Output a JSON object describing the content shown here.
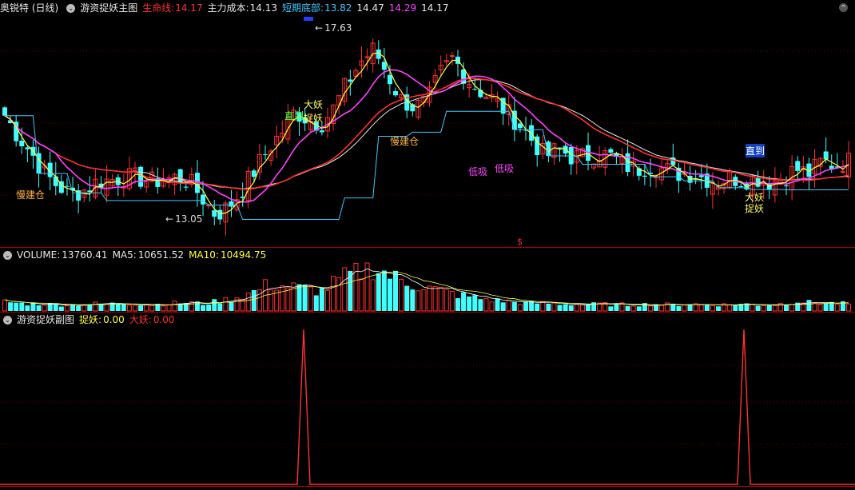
{
  "main_panel": {
    "title": "奥锐特 (日线)",
    "indicator_name": "游资捉妖主图",
    "lifeline_label": "生命线:",
    "lifeline_value": "14.17",
    "cost_label": "主力成本:",
    "cost_value": "14.13",
    "bottom_label": "短期底部:",
    "bottom_value": "13.82",
    "v4": "14.47",
    "v5": "14.29",
    "v6": "14.17",
    "high_label": "17.63",
    "low_label": "13.05",
    "annotations": [
      "慢建仓",
      "大妖",
      "捉妖",
      "直到",
      "慢建仓",
      "低吸",
      "低吸",
      "直到",
      "大妖",
      "捉妖"
    ]
  },
  "volume_panel": {
    "label": "VOLUME:",
    "volume_value": "13760.41",
    "ma5_label": "MA5:",
    "ma5_value": "10651.52",
    "ma10_label": "MA10:",
    "ma10_value": "10494.75"
  },
  "sub_panel": {
    "indicator_name": "游资捉妖副图",
    "zhuoyao_label": "捉妖:",
    "zhuoyao_value": "0.00",
    "dayao_label": "大妖:",
    "dayao_value": "0.00"
  },
  "colors": {
    "up": "#ff3030",
    "down": "#40ffff",
    "lifeline": "#ff3030",
    "cost": "#e8e8e8",
    "bottom": "#40c8ff",
    "magenta": "#ff40ff",
    "yellow": "#ffff40"
  },
  "chart_data": {
    "type": "candlestick",
    "price_range": [
      12.6,
      18.0
    ],
    "high": 17.63,
    "low": 13.05,
    "close_points": [
      15.6,
      15.1,
      14.7,
      14.2,
      13.9,
      13.7,
      13.8,
      14.0,
      14.05,
      14.1,
      14.1,
      14.0,
      14.05,
      14.1,
      14.0,
      13.6,
      13.2,
      13.4,
      13.8,
      14.3,
      14.8,
      15.2,
      15.7,
      15.5,
      15.4,
      15.8,
      16.4,
      16.9,
      17.2,
      16.6,
      16.0,
      15.8,
      15.9,
      16.6,
      17.0,
      16.5,
      16.2,
      16.0,
      15.7,
      15.4,
      15.0,
      14.6,
      14.8,
      14.6,
      14.6,
      14.7,
      14.6,
      14.4,
      14.3,
      14.4,
      14.3,
      14.2,
      14.2,
      14.1,
      14.0,
      14.1,
      14.05,
      14.1,
      14.0,
      14.1,
      14.3,
      14.2,
      14.5,
      14.4,
      14.5
    ],
    "volume_points": [
      1.2,
      1.0,
      0.9,
      0.9,
      0.8,
      0.8,
      0.9,
      0.9,
      0.9,
      1.0,
      0.9,
      0.8,
      0.9,
      1.0,
      1.1,
      0.9,
      1.2,
      1.5,
      1.9,
      2.5,
      3.4,
      3.2,
      3.0,
      2.8,
      2.5,
      3.6,
      4.5,
      5.0,
      5.6,
      4.7,
      3.9,
      3.4,
      3.0,
      2.6,
      2.2,
      1.9,
      1.6,
      1.4,
      1.2,
      1.1,
      1.0,
      1.0,
      0.9,
      0.9,
      0.8,
      0.9,
      0.8,
      0.8,
      0.8,
      0.9,
      0.8,
      0.8,
      0.9,
      0.8,
      0.8,
      0.8,
      0.9,
      0.8,
      0.8,
      0.9,
      1.3,
      1.1,
      1.0,
      1.0,
      0.9
    ],
    "sub_peaks": [
      380,
      931
    ]
  }
}
